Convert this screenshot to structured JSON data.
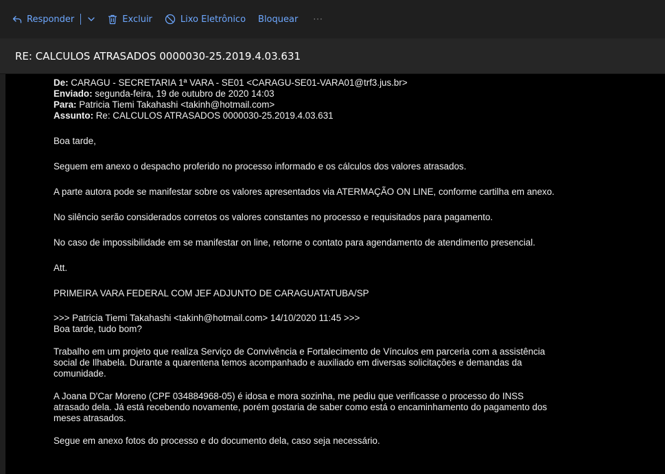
{
  "toolbar": {
    "reply_label": "Responder",
    "delete_label": "Excluir",
    "junk_label": "Lixo Eletrônico",
    "block_label": "Bloquear",
    "more_label": "···"
  },
  "message": {
    "subject": "RE: CALCULOS ATRASADOS 0000030-25.2019.4.03.631",
    "header": {
      "from_label": "De:",
      "from_value": " CARAGU - SECRETARIA 1ª VARA - SE01 <CARAGU-SE01-VARA01@trf3.jus.br>",
      "sent_label": "Enviado:",
      "sent_value": " segunda-feira, 19 de outubro de 2020 14:03",
      "to_label": "Para:",
      "to_value": " Patricia Tiemi Takahashi <takinh@hotmail.com>",
      "subject_label": "Assunto:",
      "subject_value": " Re: CALCULOS ATRASADOS 0000030-25.2019.4.03.631"
    },
    "body": {
      "greeting": "Boa tarde,",
      "p1": "Seguem em anexo o despacho proferido no processo informado e os cálculos dos valores atrasados.",
      "p2": "A parte autora pode se manifestar sobre os valores apresentados via ATERMAÇÃO ON LINE, conforme cartilha em anexo.",
      "p3": "No silêncio serão considerados corretos os valores constantes no processo e requisitados para pagamento.",
      "p4": "No caso de impossibilidade em se manifestar on line, retorne o contato para agendamento de atendimento presencial.",
      "closing": "Att.",
      "signature": "PRIMEIRA VARA FEDERAL COM JEF ADJUNTO DE CARAGUATATUBA/SP"
    },
    "quoted": {
      "header": ">>> Patricia Tiemi Takahashi <takinh@hotmail.com> 14/10/2020 11:45 >>>",
      "greeting": "Boa tarde, tudo bom?",
      "p1_line1": "Trabalho em um projeto que realiza Serviço de Convivência e Fortalecimento de Vínculos em parceria com a assistência",
      "p1_line2": "social de Ilhabela. Durante a quarentena temos acompanhado e auxiliado em diversas solicitações e demandas da",
      "p1_line3": "comunidade.",
      "p2_line1": "A Joana D'Car Moreno (CPF 034884968-05) é idosa e mora sozinha, me pediu que verificasse o processo do INSS",
      "p2_line2": "atrasado dela. Já está recebendo novamente, porém gostaria de saber como está o encaminhamento do pagamento dos",
      "p2_line3": "meses atrasados.",
      "p3": "Segue em anexo fotos do processo e do documento dela, caso seja necessário."
    }
  },
  "colors": {
    "accent": "#6ea8ff",
    "toolbar_bg": "#1f1f1f",
    "subject_bg": "#262626",
    "content_bg": "#000000",
    "text": "#f0f0f0"
  },
  "icons": {
    "reply": "reply-icon",
    "chevron": "chevron-down-icon",
    "delete": "trash-icon",
    "junk": "block-circle-icon"
  }
}
